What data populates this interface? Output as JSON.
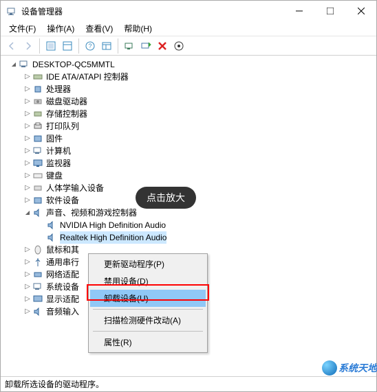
{
  "window": {
    "title": "设备管理器"
  },
  "menu": {
    "file": "文件(F)",
    "action": "操作(A)",
    "view": "查看(V)",
    "help": "帮助(H)"
  },
  "tree": {
    "root": "DESKTOP-QC5MMTL",
    "n0": "IDE ATA/ATAPI 控制器",
    "n1": "处理器",
    "n2": "磁盘驱动器",
    "n3": "存储控制器",
    "n4": "打印队列",
    "n5": "固件",
    "n6": "计算机",
    "n7": "监视器",
    "n8": "键盘",
    "n9": "人体学输入设备",
    "n10": "软件设备",
    "n11": "声音、视频和游戏控制器",
    "n11a": "NVIDIA High Definition Audio",
    "n11b": "Realtek High Definition Audio",
    "n12": "鼠标和其",
    "n13": "通用串行",
    "n14": "网络适配",
    "n15": "系统设备",
    "n16": "显示适配",
    "n17": "音频输入"
  },
  "context": {
    "update": "更新驱动程序(P)",
    "disable": "禁用设备(D)",
    "uninstall": "卸载设备(U)",
    "scan": "扫描检测硬件改动(A)",
    "props": "属性(R)"
  },
  "status": "卸载所选设备的驱动程序。",
  "tooltip": "点击放大",
  "watermark": "系统天地"
}
